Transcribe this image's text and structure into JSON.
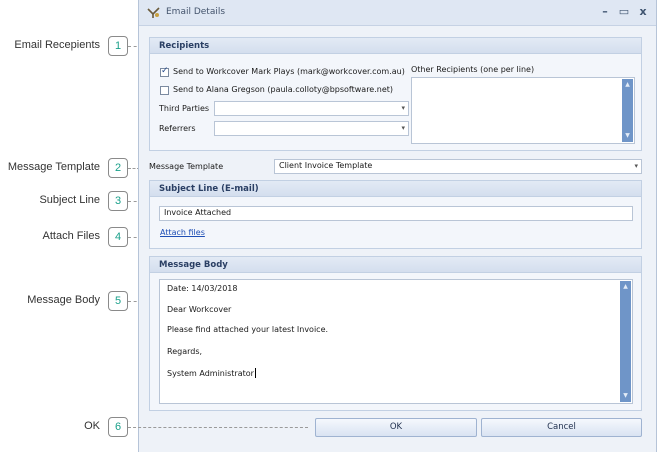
{
  "callouts": [
    {
      "num": "1",
      "label": "Email Recepients"
    },
    {
      "num": "2",
      "label": "Message Template"
    },
    {
      "num": "3",
      "label": "Subject Line"
    },
    {
      "num": "4",
      "label": "Attach Files"
    },
    {
      "num": "5",
      "label": "Message Body"
    },
    {
      "num": "6",
      "label": "OK"
    }
  ],
  "window": {
    "title": "Email Details",
    "minimize_glyph": "–",
    "maximize_glyph": "▭",
    "close_glyph": "x"
  },
  "recipients": {
    "heading": "Recipients",
    "send_workcover": {
      "label": "Send to Workcover Mark Plays (mark@workcover.com.au)",
      "checked": true
    },
    "send_alana": {
      "label": "Send to Alana Gregson (paula.colloty@bpsoftware.net)",
      "checked": false
    },
    "third_parties_label": "Third Parties",
    "third_parties_value": "",
    "referrers_label": "Referrers",
    "referrers_value": "",
    "other_label": "Other Recipients (one per line)",
    "other_value": ""
  },
  "template": {
    "label": "Message Template",
    "value": "Client Invoice Template"
  },
  "subject": {
    "heading": "Subject Line (E-mail)",
    "value": "Invoice Attached",
    "attach_link": "Attach files"
  },
  "message_body": {
    "heading": "Message Body",
    "lines": [
      "Date: 14/03/2018",
      "Dear Workcover",
      "Please find attached your latest Invoice.",
      "Regards,",
      "System Administrator"
    ]
  },
  "buttons": {
    "ok": "OK",
    "cancel": "Cancel"
  },
  "icons": {
    "app": "email-details-app-icon",
    "dropdown": "chevron-down-icon",
    "scroll_up": "scroll-up-arrow-icon",
    "scroll_down": "scroll-down-arrow-icon"
  },
  "colors": {
    "accent_callout": "#1aa08a",
    "heading_text": "#2a3f64",
    "scrollbar": "#6f95c8",
    "link": "#1f4fb5"
  }
}
